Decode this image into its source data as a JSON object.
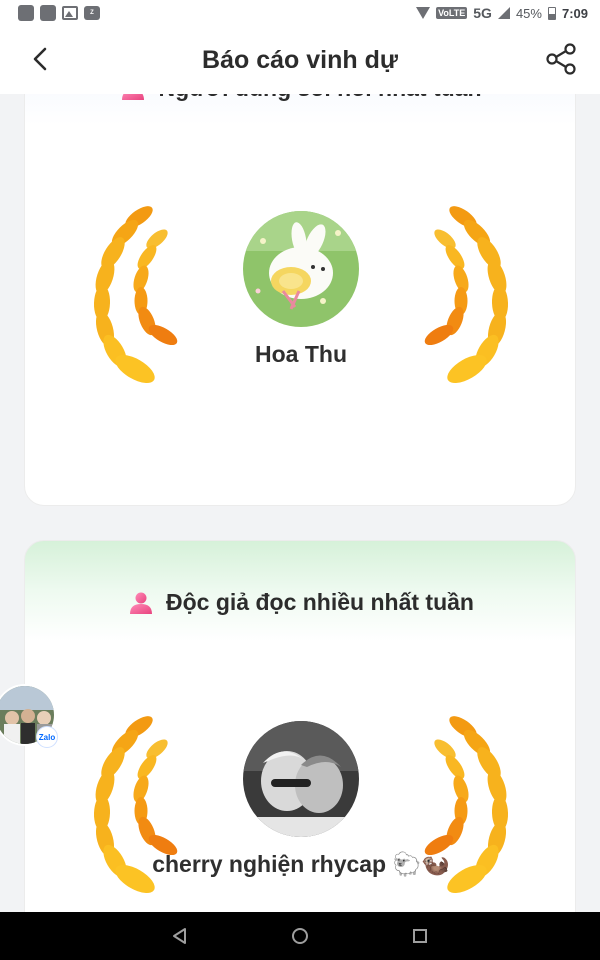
{
  "status_bar": {
    "volte": "VoLTE",
    "network": "5G",
    "battery": "45%",
    "time": "7:09",
    "icons": [
      "app-square-icon",
      "app-square-icon",
      "gallery-icon",
      "zalo-icon"
    ]
  },
  "header": {
    "title": "Báo cáo vinh dự",
    "back_icon": "chevron-left-icon",
    "share_icon": "share-icon"
  },
  "cards": [
    {
      "title": "Người dùng sôi nổi nhất tuần",
      "winner_name": "Hoa Thu",
      "icon": "person-icon"
    },
    {
      "title": "Độc giả đọc nhiều nhất tuần",
      "winner_name": "cherry nghiện rhycap 🐑🦦",
      "icon": "person-icon"
    }
  ],
  "chat_head": {
    "badge": "Zalo"
  },
  "colors": {
    "laurel_gold": "#f7b21d",
    "laurel_orange": "#f08a12",
    "person_icon": "#ee5f9a",
    "card1_tint": "#eaf0fd",
    "card2_tint": "#d6f1d9"
  }
}
